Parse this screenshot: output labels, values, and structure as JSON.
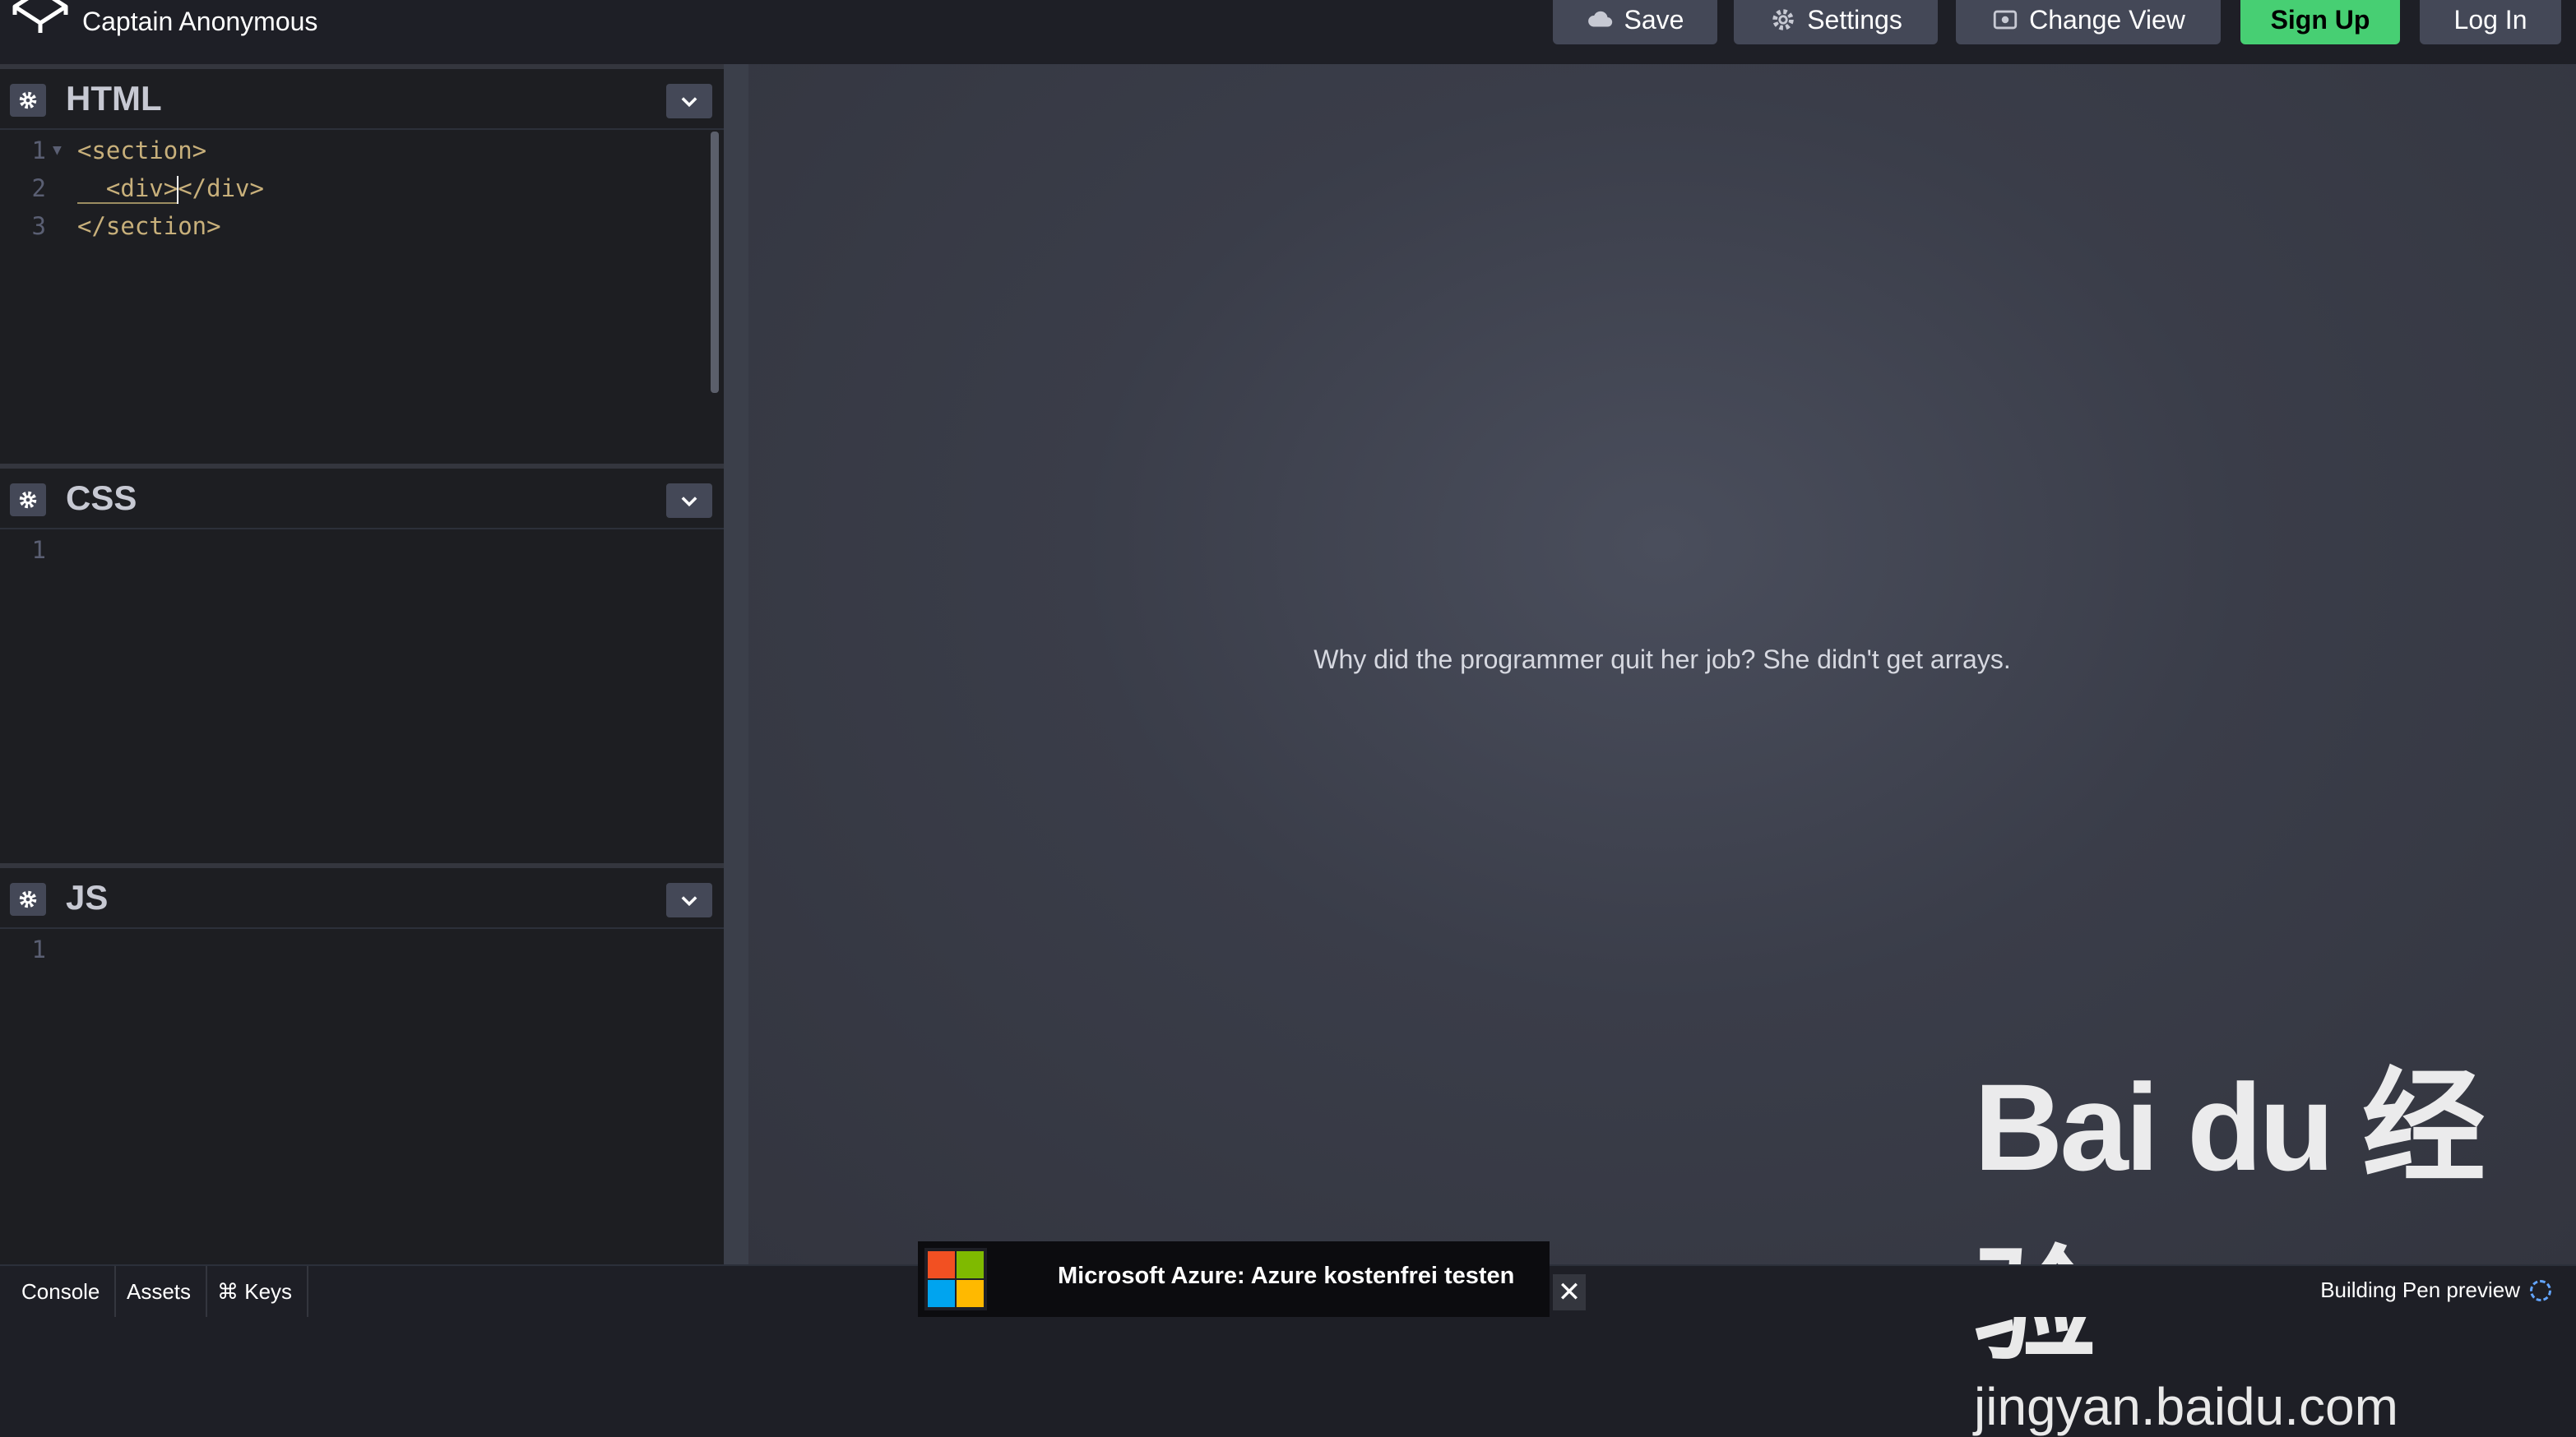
{
  "header": {
    "user_name": "Captain Anonymous",
    "buttons": {
      "save": "Save",
      "settings": "Settings",
      "change_view": "Change View",
      "sign_up": "Sign Up",
      "log_in": "Log In"
    }
  },
  "editors": {
    "html": {
      "title": "HTML",
      "lines": [
        {
          "num": "1",
          "text": "<section>"
        },
        {
          "num": "2",
          "before": "  <div>",
          "after": "</div>"
        },
        {
          "num": "3",
          "text": "</section>"
        }
      ]
    },
    "css": {
      "title": "CSS",
      "line_num": "1"
    },
    "js": {
      "title": "JS",
      "line_num": "1"
    }
  },
  "preview": {
    "joke_text": "Why did the programmer quit her job? She didn't get arrays."
  },
  "watermark": {
    "brand": "Bai du 经验",
    "url": "jingyan.baidu.com"
  },
  "footer": {
    "console": "Console",
    "assets": "Assets",
    "keys": "⌘ Keys",
    "status": "Building Pen preview"
  },
  "ad": {
    "text": "Microsoft Azure: Azure kostenfrei testen",
    "close": "✕"
  },
  "colors": {
    "accent_green": "#47cf73",
    "button_gray": "#444857",
    "code_tag": "#c8b07b"
  }
}
